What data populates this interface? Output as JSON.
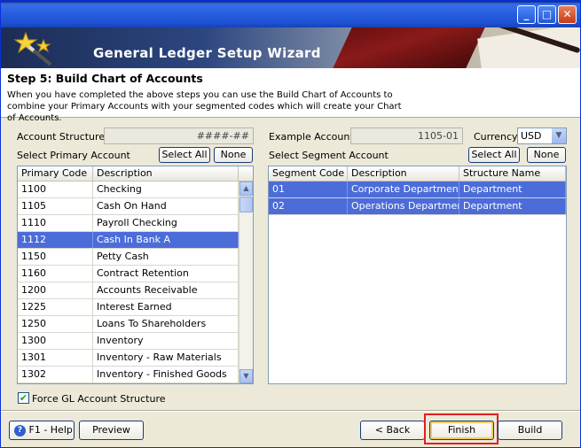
{
  "window": {
    "title": ""
  },
  "banner": {
    "title": "General Ledger Setup Wizard"
  },
  "step": {
    "title": "Step 5: Build Chart of Accounts",
    "description": "When you have completed the above steps you can use the Build Chart of Accounts to combine your Primary Accounts with your segmented codes which will create your Chart of Accounts."
  },
  "left": {
    "structure_label": "Account Structure",
    "structure_value": "####-##",
    "select_label": "Select Primary Account",
    "select_all": "Select All",
    "none": "None",
    "columns": [
      "Primary Code",
      "Description"
    ],
    "rows": [
      {
        "code": "1100",
        "desc": "Checking"
      },
      {
        "code": "1105",
        "desc": "Cash On Hand"
      },
      {
        "code": "1110",
        "desc": "Payroll Checking"
      },
      {
        "code": "1112",
        "desc": "Cash In Bank A"
      },
      {
        "code": "1150",
        "desc": "Petty Cash"
      },
      {
        "code": "1160",
        "desc": "Contract Retention"
      },
      {
        "code": "1200",
        "desc": "Accounts Receivable"
      },
      {
        "code": "1225",
        "desc": "Interest Earned"
      },
      {
        "code": "1250",
        "desc": "Loans To Shareholders"
      },
      {
        "code": "1300",
        "desc": "Inventory"
      },
      {
        "code": "1301",
        "desc": "Inventory - Raw Materials"
      },
      {
        "code": "1302",
        "desc": "Inventory - Finished Goods"
      }
    ]
  },
  "right": {
    "example_label": "Example Account",
    "example_value": "1105-01",
    "currency_label": "Currency",
    "currency_value": "USD",
    "select_label": "Select Segment Account",
    "select_all": "Select All",
    "none": "None",
    "columns": [
      "Segment Code",
      "Description",
      "Structure Name"
    ],
    "rows": [
      {
        "code": "01",
        "desc": "Corporate Department",
        "structure": "Department"
      },
      {
        "code": "02",
        "desc": "Operations Department",
        "structure": "Department"
      }
    ]
  },
  "force_label": "Force GL Account Structure",
  "footer": {
    "help": "F1 - Help",
    "preview": "Preview",
    "back": "< Back",
    "finish": "Finish",
    "build": "Build"
  }
}
